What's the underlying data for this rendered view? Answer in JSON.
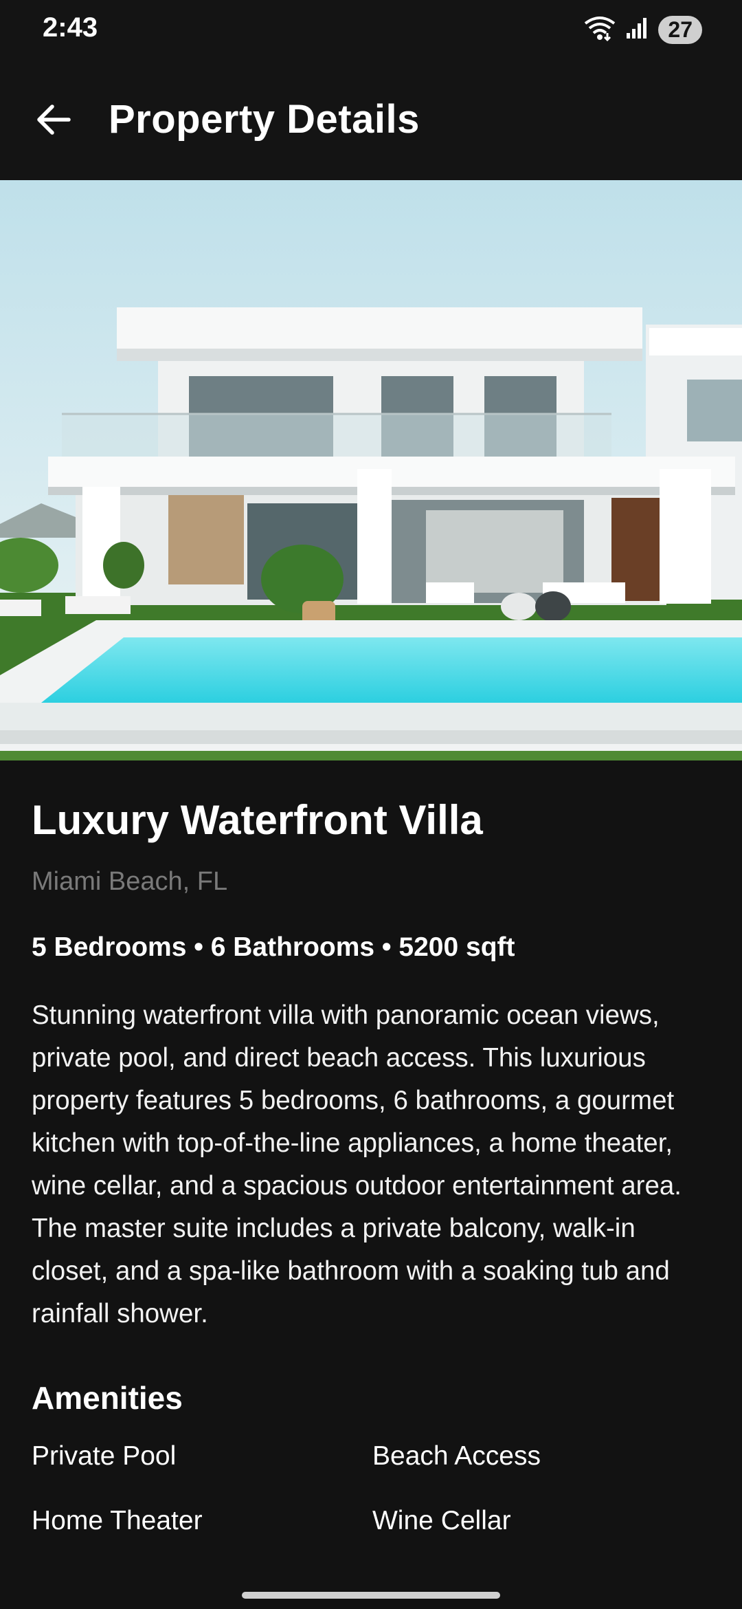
{
  "status": {
    "time": "2:43",
    "battery": "27"
  },
  "appbar": {
    "title": "Property Details"
  },
  "property": {
    "name": "Luxury Waterfront Villa",
    "location": "Miami Beach, FL",
    "specs": "5 Bedrooms • 6 Bathrooms • 5200 sqft",
    "description": "Stunning waterfront villa with panoramic ocean views, private pool, and direct beach access. This luxurious property features 5 bedrooms, 6 bathrooms, a gourmet kitchen with top-of-the-line appliances, a home theater, wine cellar, and a spacious outdoor entertainment area. The master suite includes a private balcony, walk-in closet, and a spa-like bathroom with a soaking tub and rainfall shower."
  },
  "amenities": {
    "title": "Amenities",
    "items": [
      "Private Pool",
      "Beach Access",
      "Home Theater",
      "Wine Cellar"
    ]
  }
}
